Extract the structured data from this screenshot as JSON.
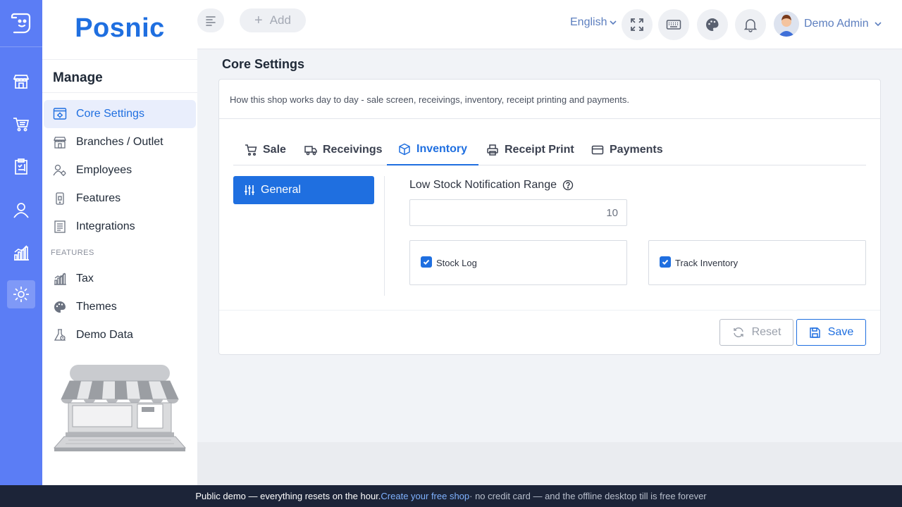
{
  "app": {
    "brand": "Posnic"
  },
  "rail": {
    "items": [
      {
        "name": "store-icon",
        "active": false
      },
      {
        "name": "cart-icon",
        "active": false
      },
      {
        "name": "clipboard-icon",
        "active": false
      },
      {
        "name": "user-icon",
        "active": false
      },
      {
        "name": "chart-icon",
        "active": false
      },
      {
        "name": "settings-icon",
        "active": true
      }
    ]
  },
  "sidebar": {
    "heading": "Manage",
    "items": [
      {
        "label": "Core Settings",
        "icon": "settings-window-icon",
        "active": true
      },
      {
        "label": "Branches / Outlet",
        "icon": "building-icon"
      },
      {
        "label": "Employees",
        "icon": "user-gear-icon"
      },
      {
        "label": "Features",
        "icon": "phone-icon"
      },
      {
        "label": "Integrations",
        "icon": "list-icon"
      }
    ],
    "section_label": "FEATURES",
    "feature_items": [
      {
        "label": "Tax",
        "icon": "chart-icon"
      },
      {
        "label": "Themes",
        "icon": "palette-icon"
      },
      {
        "label": "Demo Data",
        "icon": "flask-icon"
      }
    ]
  },
  "topbar": {
    "add_label": "Add",
    "language": "English",
    "user_name": "Demo Admin"
  },
  "page": {
    "title": "Core Settings",
    "description": "How this shop works day to day - sale screen, receivings, inventory, receipt printing and payments.",
    "tabs": [
      {
        "label": "Sale",
        "icon": "cart-icon"
      },
      {
        "label": "Receivings",
        "icon": "truck-icon"
      },
      {
        "label": "Inventory",
        "icon": "box-icon",
        "active": true
      },
      {
        "label": "Receipt Print",
        "icon": "printer-icon"
      },
      {
        "label": "Payments",
        "icon": "card-icon"
      }
    ],
    "subnav_active": "General",
    "low_stock_label": "Low Stock Notification Range",
    "low_stock_value": "10",
    "checkboxes": [
      {
        "label": "Stock Log",
        "checked": true
      },
      {
        "label": "Track Inventory",
        "checked": true
      }
    ],
    "reset_label": "Reset",
    "save_label": "Save"
  },
  "banner": {
    "text1": "Public demo — everything resets on the hour.",
    "link": "Create your free shop",
    "text2": "· no credit card — and the offline desktop till is free forever"
  },
  "colors": {
    "accent": "#1f6fe0",
    "rail": "#5b7df5",
    "banner": "#1c2438"
  }
}
